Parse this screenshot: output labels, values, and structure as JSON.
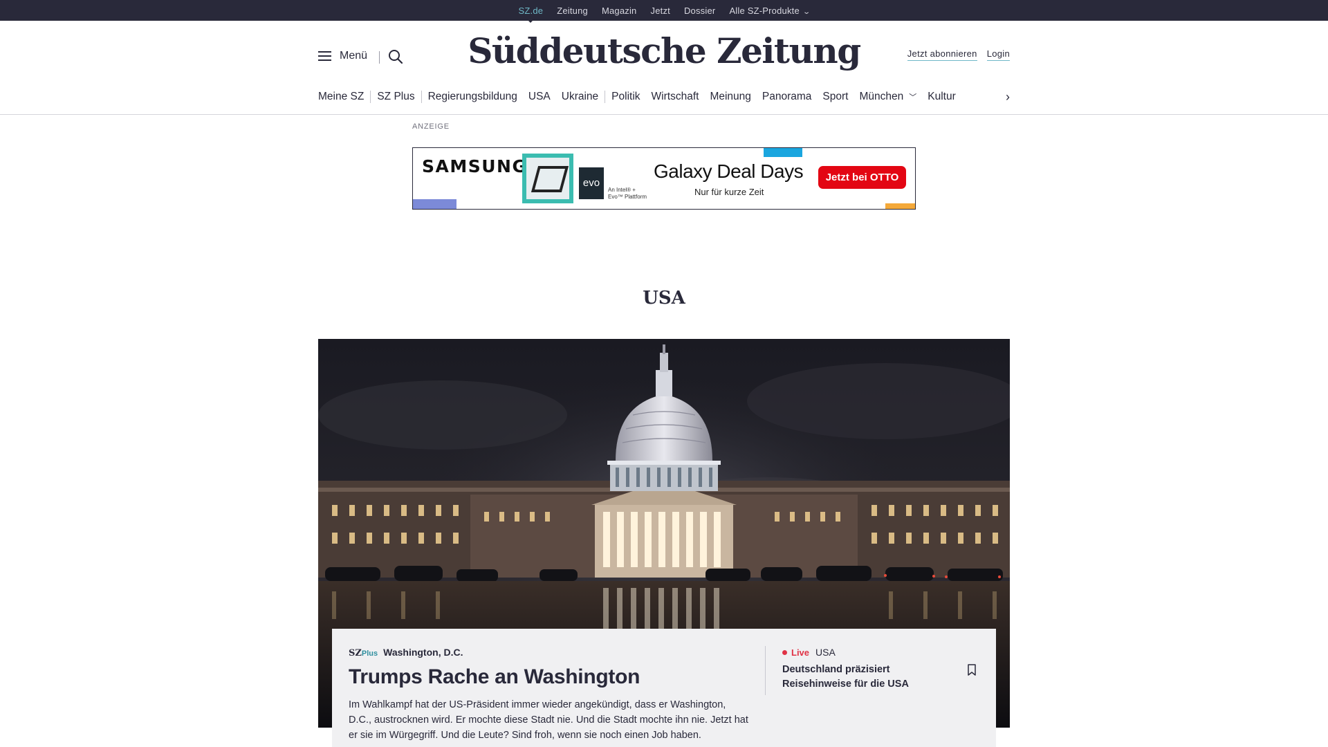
{
  "topbar": {
    "links": [
      "SZ.de",
      "Zeitung",
      "Magazin",
      "Jetzt",
      "Dossier"
    ],
    "products": "Alle SZ-Produkte"
  },
  "header": {
    "menu_label": "Menü",
    "logo": "Süddeutsche Zeitung",
    "subscribe": "Jetzt abonnieren",
    "login": "Login"
  },
  "nav": {
    "meine_sz": "Meine SZ",
    "sz_plus": "SZ Plus",
    "regierungsbildung": "Regierungsbildung",
    "usa": "USA",
    "ukraine": "Ukraine",
    "politik": "Politik",
    "wirtschaft": "Wirtschaft",
    "meinung": "Meinung",
    "panorama": "Panorama",
    "sport": "Sport",
    "muenchen": "München",
    "kultur": "Kultur"
  },
  "ad": {
    "label": "ANZEIGE",
    "brand": "SAMSUNG",
    "intel_badge": "evo",
    "intel_text": "An Intel® +\nEvo™ Plattform",
    "headline": "Galaxy Deal Days",
    "sub": "Nur für kurze Zeit",
    "cta": "Jetzt bei OTTO"
  },
  "section": {
    "title": "USA"
  },
  "teaser": {
    "badge_sz": "SZ",
    "badge_plus": "Plus",
    "place": "Washington, D.C.",
    "title": "Trumps Rache an Washington",
    "text": "Im Wahlkampf hat der US-Präsident immer wieder angekündigt, dass er Washington, D.C., austrocknen wird. Er mochte diese Stadt nie. Und die Stadt mochte ihn nie. Jetzt hat er sie im Würgegriff. Und die Leute? Sind froh, wenn sie noch einen Job haben."
  },
  "side": {
    "live_label": "Live",
    "topic": "USA",
    "title": "Deutschland präzisiert Reisehinweise für die USA"
  }
}
